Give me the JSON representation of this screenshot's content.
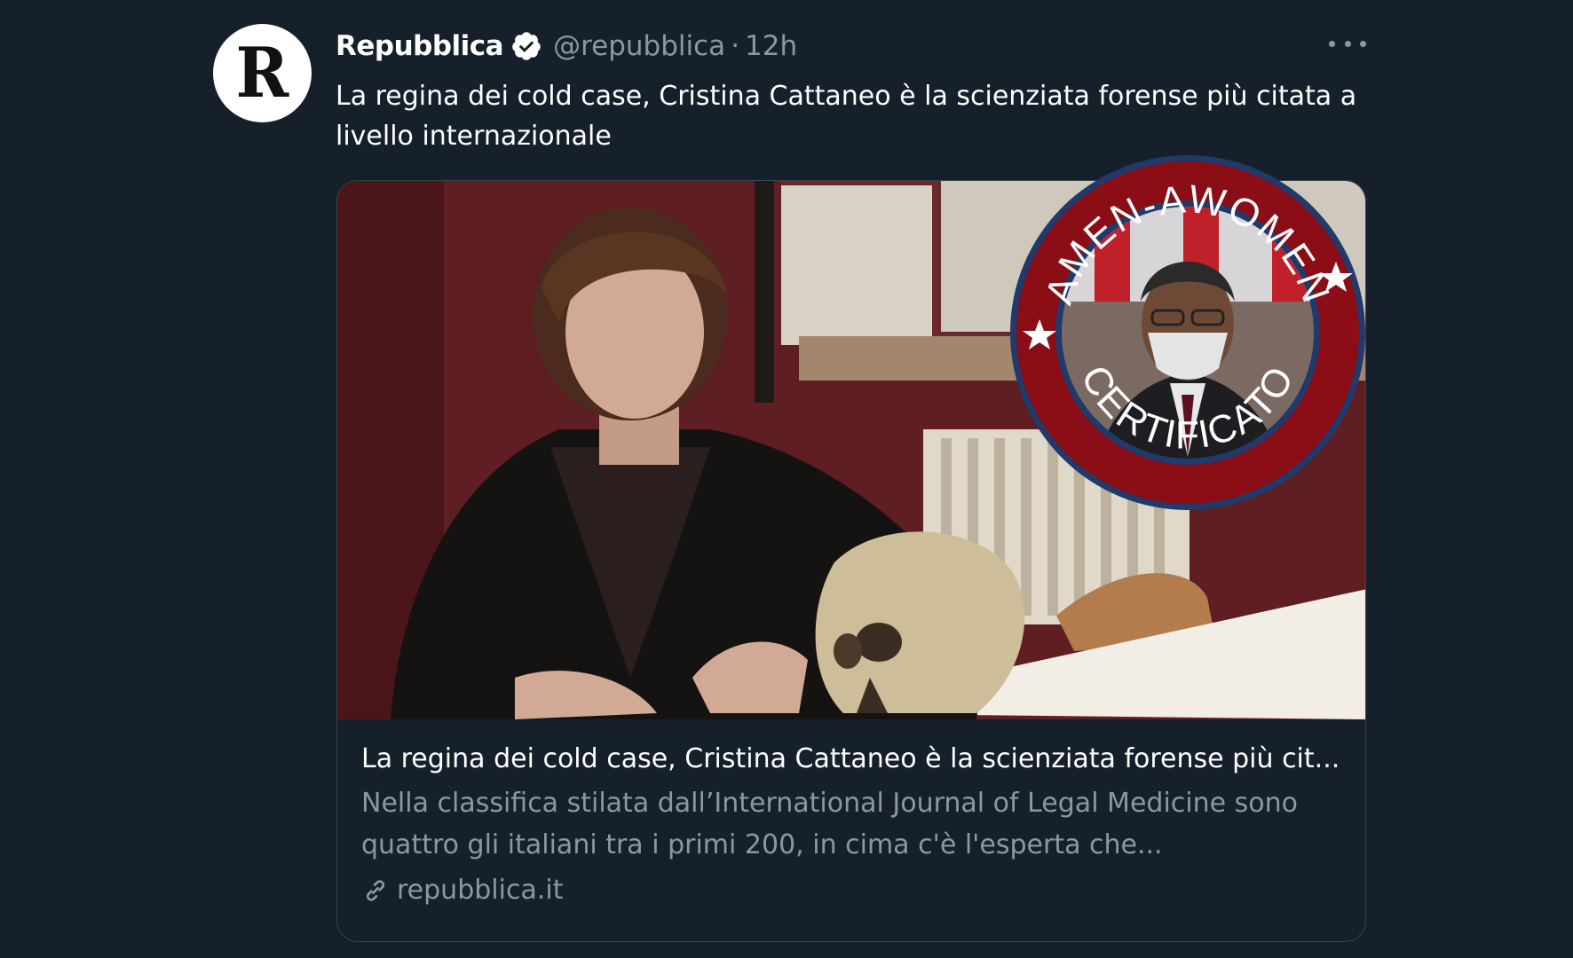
{
  "tweet": {
    "avatar_letter": "R",
    "display_name": "Repubblica",
    "handle": "@repubblica",
    "separator": "·",
    "time": "12h",
    "text": "La regina dei cold case, Cristina Cattaneo è la scienziata forense più citata a livello internazionale"
  },
  "card": {
    "title": "La regina dei cold case, Cristina Cattaneo è la scienziata forense più cit...",
    "description": "Nella classifica stilata dall’International Journal of Legal Medicine sono quattro gli italiani tra i primi 200, in cima c'è l'esperta che...",
    "domain": "repubblica.it"
  },
  "badge": {
    "top_text": "AMEN-AWOMEN",
    "bottom_text": "CERTIFICATO"
  },
  "icons": {
    "verified": "verified-badge-icon",
    "more": "more-options-icon",
    "link": "link-icon"
  },
  "colors": {
    "background": "#15202b",
    "secondary_text": "#8899a6",
    "badge_ring": "#8b0d16",
    "badge_border": "#1f3a6b"
  }
}
